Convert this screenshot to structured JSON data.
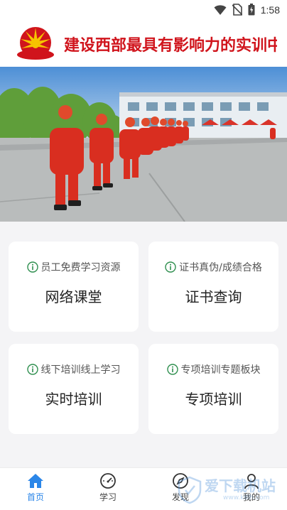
{
  "status_bar": {
    "time": "1:58",
    "icons": [
      "wifi-icon",
      "no-sim-icon",
      "battery-icon"
    ]
  },
  "header": {
    "marquee_text": "建设西部最具有影响力的实训中",
    "marquee_color": "#d0141c"
  },
  "banner": {
    "dots": [
      {
        "active": false
      },
      {
        "active": false
      },
      {
        "active": true
      }
    ],
    "active_color": "#2b86e8"
  },
  "cards": [
    {
      "subtitle": "员工免费学习资源",
      "title": "网络课堂",
      "icon": "info-icon"
    },
    {
      "subtitle": "证书真伪/成绩合格",
      "title": "证书查询",
      "icon": "info-icon"
    },
    {
      "subtitle": "线下培训线上学习",
      "title": "实时培训",
      "icon": "info-icon"
    },
    {
      "subtitle": "专项培训专题板块",
      "title": "专项培训",
      "icon": "info-icon"
    }
  ],
  "bottom_nav": {
    "items": [
      {
        "label": "首页",
        "icon": "home-icon",
        "active": true
      },
      {
        "label": "学习",
        "icon": "gauge-icon",
        "active": false
      },
      {
        "label": "发现",
        "icon": "compass-icon",
        "active": false
      },
      {
        "label": "我的",
        "icon": "user-icon",
        "active": false
      }
    ],
    "active_color": "#2b86e8"
  },
  "watermark": {
    "text": "爱下载机站",
    "url": "www.k8lh.com"
  }
}
